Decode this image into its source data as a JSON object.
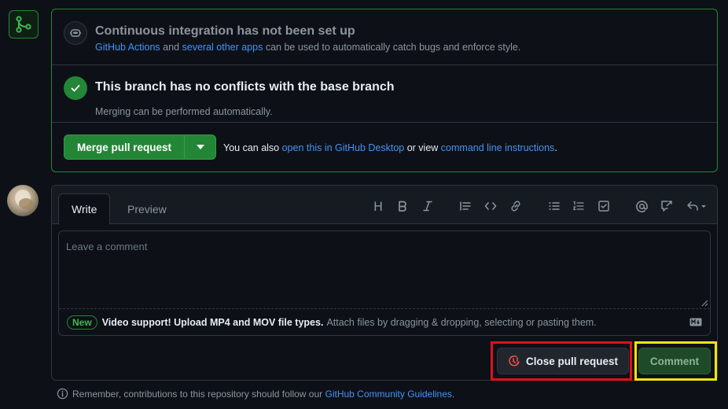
{
  "merge_box": {
    "ci": {
      "title": "Continuous integration has not been set up",
      "link1": "GitHub Actions",
      "mid": " and ",
      "link2": "several other apps",
      "rest": " can be used to automatically catch bugs and enforce style."
    },
    "conflicts": {
      "title": "This branch has no conflicts with the base branch",
      "subtitle": "Merging can be performed automatically."
    },
    "action": {
      "merge_label": "Merge pull request",
      "text1": "You can also ",
      "link1": "open this in GitHub Desktop",
      "text2": " or view ",
      "link2": "command line instructions",
      "text3": "."
    }
  },
  "comment_box": {
    "tabs": {
      "write": "Write",
      "preview": "Preview"
    },
    "toolbar": {
      "heading": "H",
      "icons": [
        "heading-icon",
        "bold-icon",
        "italic-icon",
        "quote-icon",
        "code-icon",
        "link-icon",
        "unordered-list-icon",
        "ordered-list-icon",
        "task-list-icon",
        "mention-icon",
        "reference-icon",
        "reply-icon"
      ]
    },
    "placeholder": "Leave a comment",
    "attach": {
      "badge": "New",
      "bold": "Video support! Upload MP4 and MOV file types.",
      "rest": " Attach files by dragging & dropping, selecting or pasting them."
    },
    "close_label": "Close pull request",
    "comment_label": "Comment"
  },
  "footer": {
    "text": "Remember, contributions to this repository should follow our ",
    "link": "GitHub Community Guidelines",
    "end": "."
  },
  "colors": {
    "background": "#0d1117",
    "success": "#238636",
    "link": "#4493f8",
    "highlight_red": "#e0101a",
    "highlight_yellow": "#f5e50a"
  }
}
